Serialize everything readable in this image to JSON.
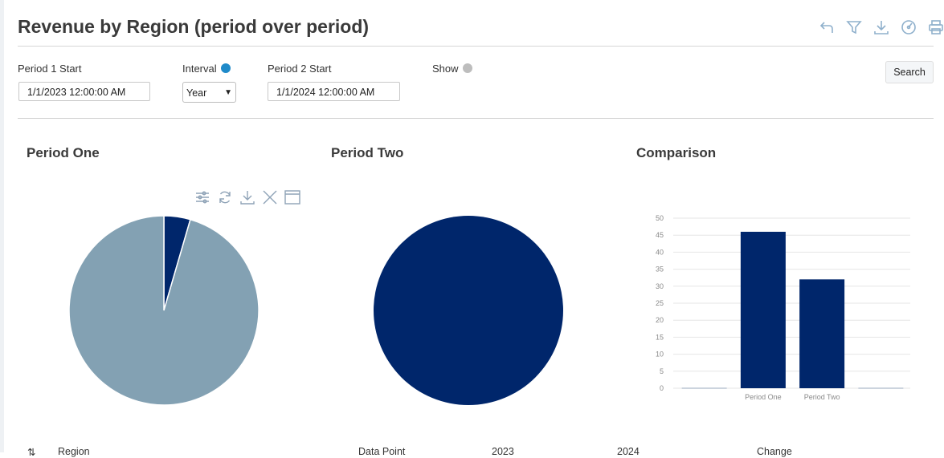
{
  "page": {
    "title": "Revenue by Region (period over period)"
  },
  "toolbar": {
    "icons": [
      "undo-icon",
      "filter-icon",
      "download-icon",
      "dashboard-icon",
      "print-icon"
    ]
  },
  "filters": {
    "period1_label": "Period 1 Start",
    "period1_value": "1/1/2023 12:00:00 AM",
    "interval_label": "Interval",
    "interval_value": "Year",
    "period2_label": "Period 2 Start",
    "period2_value": "1/1/2024 12:00:00 AM",
    "show_label": "Show",
    "search_label": "Search",
    "interval_dot_color": "#1f8ac9",
    "show_dot_color": "#bdbdbd"
  },
  "panels": {
    "one_title": "Period One",
    "two_title": "Period Two",
    "comparison_title": "Comparison"
  },
  "chart_tools": {
    "icons": [
      "settings-icon",
      "refresh-icon",
      "download-icon",
      "close-icon",
      "maximize-icon"
    ]
  },
  "chart_data": [
    {
      "type": "pie",
      "slices": [
        {
          "value": 4.5,
          "color": "#00266b"
        },
        {
          "value": 95.5,
          "color": "#83a1b3"
        }
      ]
    },
    {
      "type": "pie",
      "slices": [
        {
          "value": 100,
          "color": "#00266b"
        }
      ]
    },
    {
      "type": "bar",
      "categories": [
        "",
        "Period One",
        "Period Two",
        ""
      ],
      "values": [
        0,
        46,
        32,
        0
      ],
      "ylim": [
        0,
        50
      ],
      "yticks": [
        0,
        5,
        10,
        15,
        20,
        25,
        30,
        35,
        40,
        45,
        50
      ],
      "grid": true,
      "color": "#00266b"
    }
  ],
  "table": {
    "columns": [
      "Region",
      "Data Point",
      "2023",
      "2024",
      "Change"
    ]
  }
}
